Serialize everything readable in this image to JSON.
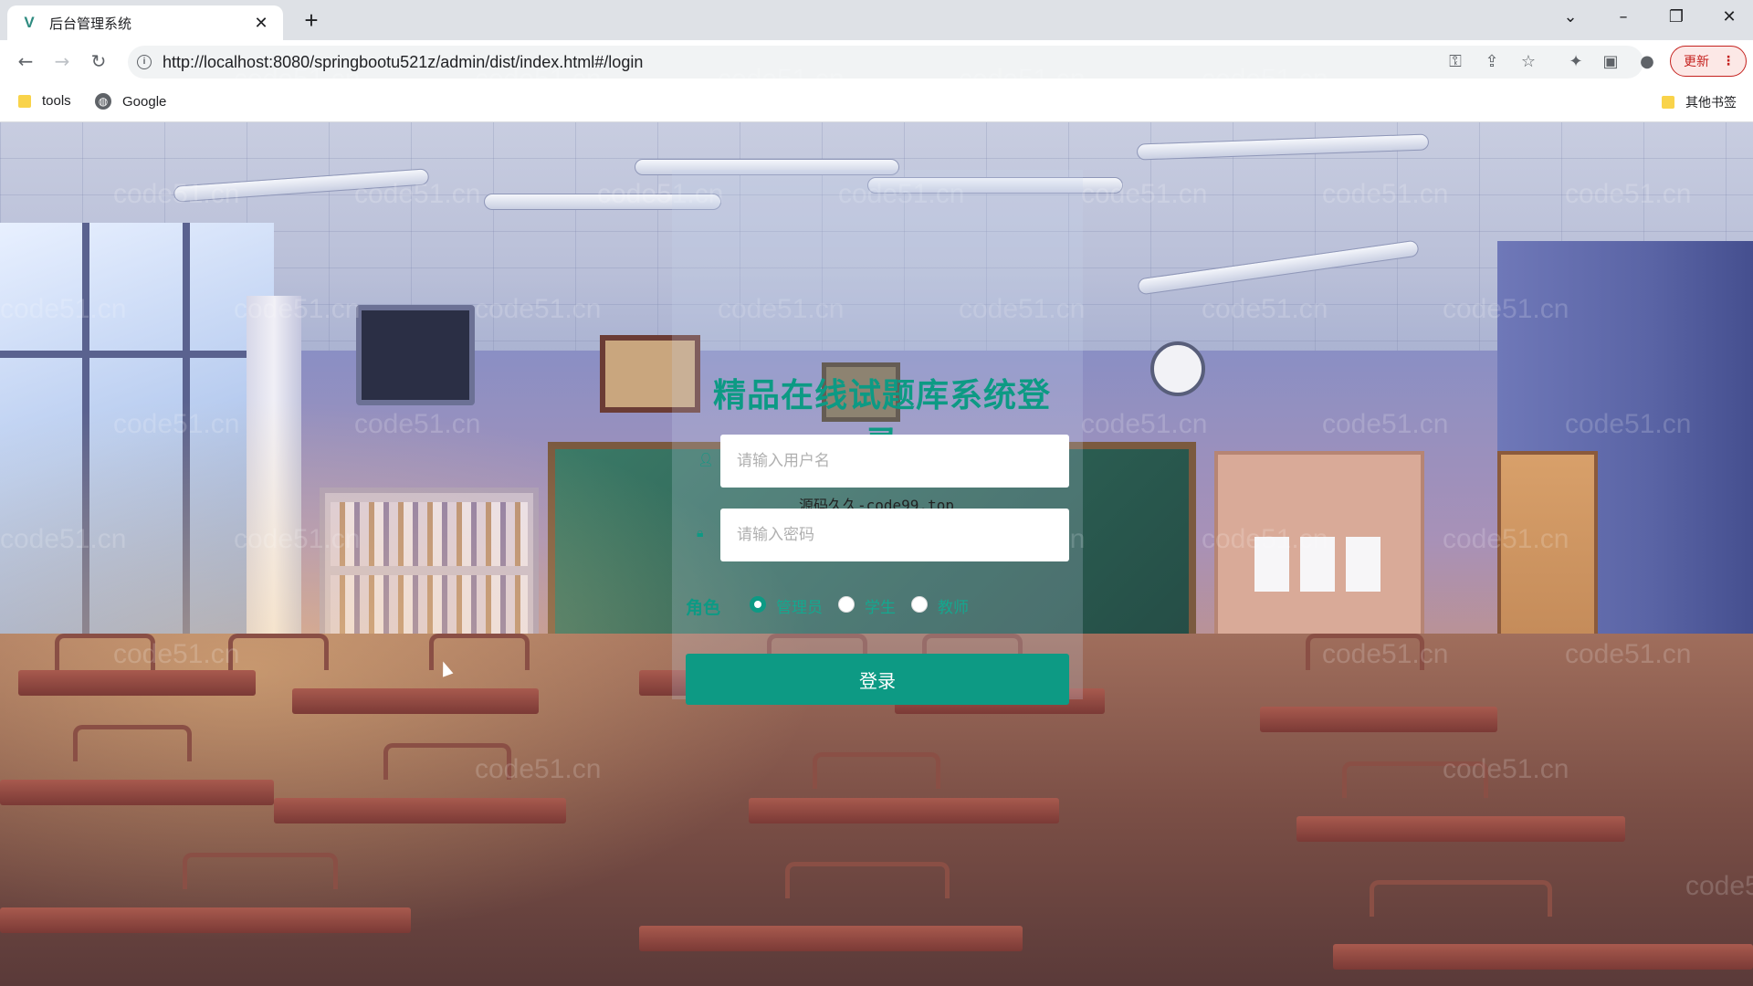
{
  "browser": {
    "tab_title": "后台管理系统",
    "tab_icon": "vue-logo-icon",
    "tab_close": "✕",
    "new_tab": "+",
    "url": "http://localhost:8080/springbootu521z/admin/dist/index.html#/login",
    "update_label": "更新",
    "window_controls": {
      "dropdown": "⌄",
      "minimize": "–",
      "restore": "❐",
      "close": "✕"
    }
  },
  "bookmarks": {
    "items": [
      {
        "label": "tools",
        "icon": "folder-icon"
      },
      {
        "label": "Google",
        "icon": "globe-icon"
      }
    ],
    "other_label": "其他书签"
  },
  "login": {
    "title": "精品在线试题库系统登录",
    "username_placeholder": "请输入用户名",
    "password_placeholder": "请输入密码",
    "ad_text": "源码久久-code99.top",
    "role_label": "角色",
    "roles": [
      "管理员",
      "学生",
      "教师"
    ],
    "selected_role": "管理员",
    "submit_label": "登录"
  },
  "watermark": "code51.cn",
  "colors": {
    "accent": "#0d9a84",
    "update": "#c5221f"
  }
}
